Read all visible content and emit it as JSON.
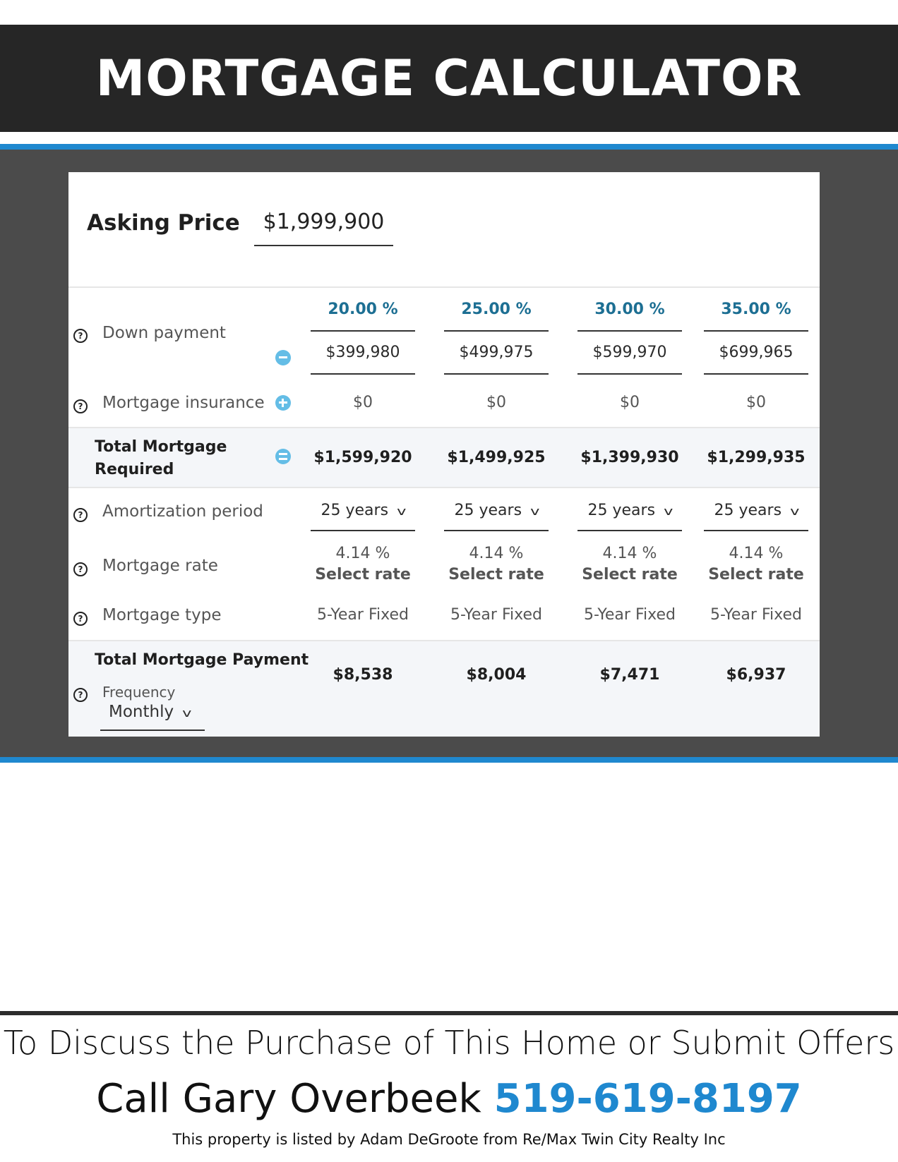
{
  "header": {
    "title": "MORTGAGE CALCULATOR"
  },
  "calculator": {
    "asking_price_label": "Asking Price",
    "asking_price_value": "$1,999,900",
    "rows": {
      "down_payment": "Down payment",
      "mortgage_insurance": "Mortgage insurance",
      "total_required_line1": "Total Mortgage",
      "total_required_line2": "Required",
      "amortization": "Amortization period",
      "rate": "Mortgage rate",
      "type": "Mortgage type",
      "total_payment": "Total Mortgage Payment",
      "frequency": "Frequency",
      "frequency_value": "Monthly"
    },
    "columns": [
      {
        "percent": "20.00 %",
        "down": "$399,980",
        "insurance": "$0",
        "total": "$1,599,920",
        "amort": "25 years",
        "rate": "4.14 %",
        "select": "Select rate",
        "type": "5-Year Fixed",
        "payment": "$8,538"
      },
      {
        "percent": "25.00 %",
        "down": "$499,975",
        "insurance": "$0",
        "total": "$1,499,925",
        "amort": "25 years",
        "rate": "4.14 %",
        "select": "Select rate",
        "type": "5-Year Fixed",
        "payment": "$8,004"
      },
      {
        "percent": "30.00 %",
        "down": "$599,970",
        "insurance": "$0",
        "total": "$1,399,930",
        "amort": "25 years",
        "rate": "4.14 %",
        "select": "Select rate",
        "type": "5-Year Fixed",
        "payment": "$7,471"
      },
      {
        "percent": "35.00 %",
        "down": "$699,965",
        "insurance": "$0",
        "total": "$1,299,935",
        "amort": "25 years",
        "rate": "4.14 %",
        "select": "Select rate",
        "type": "5-Year Fixed",
        "payment": "$6,937"
      }
    ],
    "icons": {
      "help": "?",
      "chevron": "v"
    }
  },
  "footer": {
    "line1": "To Discuss the Purchase of This Home or Submit Offers",
    "call_text": "Call Gary Overbeek ",
    "phone": "519-619-8197",
    "listing_note": "This property is listed by Adam DeGroote from Re/Max Twin City Realty Inc"
  },
  "colors": {
    "accent": "#1f88cf",
    "dark": "#262626",
    "band": "#4b4b4b",
    "percent": "#1d6f93",
    "control": "#64bde6"
  }
}
